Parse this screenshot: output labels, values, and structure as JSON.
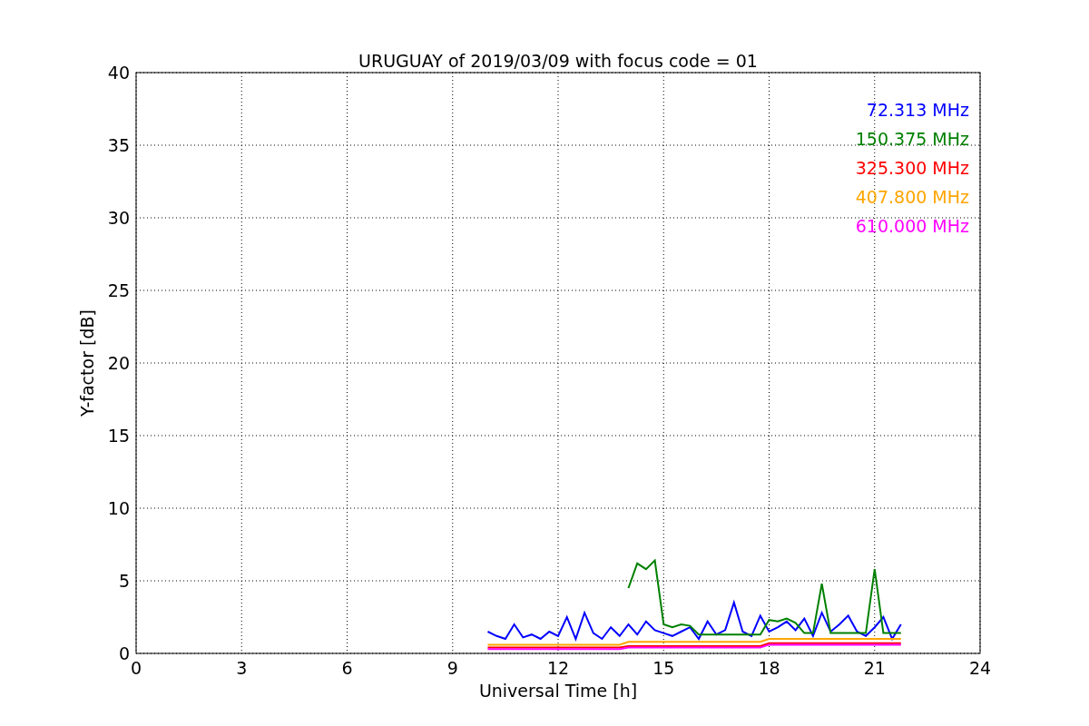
{
  "chart_data": {
    "type": "line",
    "title": "URUGUAY of 2019/03/09 with focus code = 01",
    "xlabel": "Universal Time [h]",
    "ylabel": "Y-factor [dB]",
    "x": [
      10,
      10.25,
      10.5,
      10.75,
      11,
      11.25,
      11.5,
      11.75,
      12,
      12.25,
      12.5,
      12.75,
      13,
      13.25,
      13.5,
      13.75,
      14,
      14.25,
      14.5,
      14.75,
      15,
      15.25,
      15.5,
      15.75,
      16,
      16.25,
      16.5,
      16.75,
      17,
      17.25,
      17.5,
      17.75,
      18,
      18.25,
      18.5,
      18.75,
      19,
      19.25,
      19.5,
      19.75,
      20,
      20.25,
      20.5,
      20.75,
      21,
      21.25,
      21.5,
      21.75
    ],
    "series": [
      {
        "name": "72.313 MHz",
        "color": "#0000ff",
        "values": [
          1.5,
          1.2,
          1.0,
          2.0,
          1.1,
          1.3,
          1.0,
          1.5,
          1.2,
          2.5,
          1.0,
          2.8,
          1.4,
          1.0,
          1.8,
          1.2,
          2.0,
          1.3,
          2.2,
          1.6,
          1.4,
          1.2,
          1.5,
          1.8,
          1.0,
          2.2,
          1.3,
          1.6,
          3.5,
          1.5,
          1.2,
          2.6,
          1.5,
          1.8,
          2.2,
          1.6,
          2.4,
          1.2,
          2.8,
          1.5,
          2.0,
          2.6,
          1.5,
          1.2,
          1.8,
          2.5,
          1.0,
          2.0
        ]
      },
      {
        "name": "150.375 MHz",
        "color": "#008000",
        "values": [
          null,
          null,
          null,
          null,
          null,
          null,
          null,
          null,
          null,
          null,
          null,
          null,
          null,
          null,
          null,
          null,
          4.5,
          6.2,
          5.8,
          6.4,
          2.0,
          1.8,
          2.0,
          1.9,
          1.3,
          1.3,
          1.3,
          1.3,
          1.3,
          1.3,
          1.3,
          1.3,
          2.3,
          2.2,
          2.4,
          2.1,
          1.4,
          1.4,
          4.8,
          1.4,
          1.4,
          1.4,
          1.4,
          1.4,
          5.8,
          1.4,
          1.4,
          1.4
        ]
      },
      {
        "name": "325.300 MHz",
        "color": "#ff0000",
        "values": [
          0.4,
          0.4,
          0.4,
          0.4,
          0.4,
          0.4,
          0.4,
          0.4,
          0.4,
          0.4,
          0.4,
          0.4,
          0.4,
          0.4,
          0.4,
          0.4,
          0.5,
          0.5,
          0.5,
          0.5,
          0.5,
          0.5,
          0.5,
          0.5,
          0.5,
          0.5,
          0.5,
          0.5,
          0.5,
          0.5,
          0.5,
          0.5,
          0.7,
          0.7,
          0.7,
          0.7,
          0.7,
          0.7,
          0.7,
          0.7,
          0.7,
          0.7,
          0.7,
          0.7,
          0.7,
          0.7,
          0.7,
          0.7
        ]
      },
      {
        "name": "407.800 MHz",
        "color": "#ffa500",
        "values": [
          0.6,
          0.6,
          0.6,
          0.6,
          0.6,
          0.6,
          0.6,
          0.6,
          0.6,
          0.6,
          0.6,
          0.6,
          0.6,
          0.6,
          0.6,
          0.6,
          0.8,
          0.8,
          0.8,
          0.8,
          0.8,
          0.8,
          0.8,
          0.8,
          0.8,
          0.8,
          0.8,
          0.8,
          0.8,
          0.8,
          0.8,
          0.8,
          1.0,
          1.0,
          1.0,
          1.0,
          1.0,
          1.0,
          1.0,
          1.0,
          1.0,
          1.0,
          1.0,
          1.0,
          1.0,
          1.0,
          1.0,
          1.0
        ]
      },
      {
        "name": "610.000 MHz",
        "color": "#ff00ff",
        "values": [
          0.3,
          0.3,
          0.3,
          0.3,
          0.3,
          0.3,
          0.3,
          0.3,
          0.3,
          0.3,
          0.3,
          0.3,
          0.3,
          0.3,
          0.3,
          0.3,
          0.4,
          0.4,
          0.4,
          0.4,
          0.4,
          0.4,
          0.4,
          0.4,
          0.4,
          0.4,
          0.4,
          0.4,
          0.4,
          0.4,
          0.4,
          0.4,
          0.6,
          0.6,
          0.6,
          0.6,
          0.6,
          0.6,
          0.6,
          0.6,
          0.6,
          0.6,
          0.6,
          0.6,
          0.6,
          0.6,
          0.6,
          0.6
        ]
      }
    ],
    "grid": true,
    "xlim": [
      0,
      24
    ],
    "ylim": [
      0,
      40
    ],
    "xticks": [
      0,
      3,
      6,
      9,
      12,
      15,
      18,
      21,
      24
    ],
    "yticks": [
      0,
      5,
      10,
      15,
      20,
      25,
      30,
      35,
      40
    ]
  }
}
